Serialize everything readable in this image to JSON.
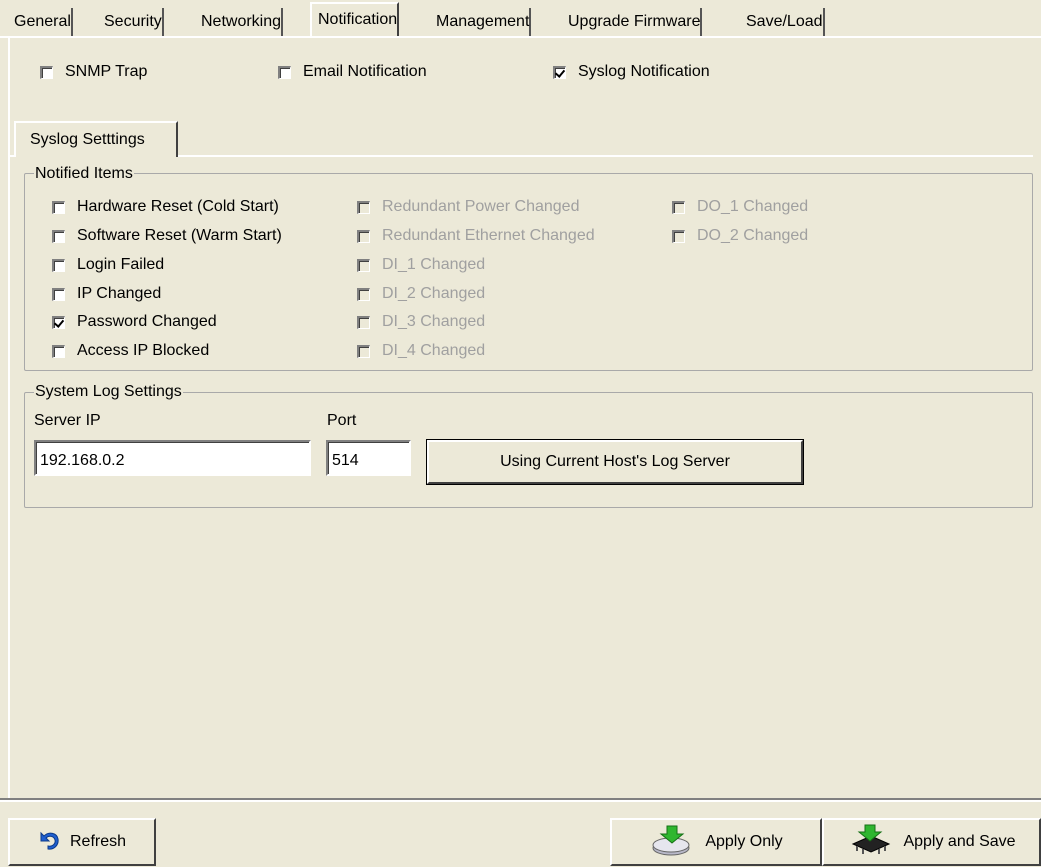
{
  "tabs": [
    "General",
    "Security",
    "Networking",
    "Notification",
    "Management",
    "Upgrade Firmware",
    "Save/Load"
  ],
  "active_tab": "Notification",
  "notification_types": [
    {
      "label": "SNMP Trap",
      "checked": false
    },
    {
      "label": "Email Notification",
      "checked": false
    },
    {
      "label": "Syslog Notification",
      "checked": true
    }
  ],
  "sub_tab": "Syslog Setttings",
  "notified_items": {
    "legend": "Notified Items",
    "col1": [
      {
        "label": "Hardware Reset (Cold Start)",
        "checked": false,
        "enabled": true
      },
      {
        "label": "Software Reset (Warm Start)",
        "checked": false,
        "enabled": true
      },
      {
        "label": "Login Failed",
        "checked": false,
        "enabled": true
      },
      {
        "label": "IP Changed",
        "checked": false,
        "enabled": true
      },
      {
        "label": "Password Changed",
        "checked": true,
        "enabled": true
      },
      {
        "label": "Access IP Blocked",
        "checked": false,
        "enabled": true
      }
    ],
    "col2": [
      {
        "label": "Redundant Power Changed",
        "checked": false,
        "enabled": false
      },
      {
        "label": "Redundant Ethernet Changed",
        "checked": false,
        "enabled": false
      },
      {
        "label": "DI_1 Changed",
        "checked": false,
        "enabled": false
      },
      {
        "label": "DI_2 Changed",
        "checked": false,
        "enabled": false
      },
      {
        "label": "DI_3 Changed",
        "checked": false,
        "enabled": false
      },
      {
        "label": "DI_4 Changed",
        "checked": false,
        "enabled": false
      }
    ],
    "col3": [
      {
        "label": "DO_1 Changed",
        "checked": false,
        "enabled": false
      },
      {
        "label": "DO_2 Changed",
        "checked": false,
        "enabled": false
      }
    ]
  },
  "system_log": {
    "legend": "System Log Settings",
    "server_ip_label": "Server IP",
    "server_ip_value": "192.168.0.2",
    "port_label": "Port",
    "port_value": "514",
    "use_host_button": "Using Current Host's Log Server"
  },
  "footer": {
    "refresh": "Refresh",
    "apply_only": "Apply Only",
    "apply_save": "Apply and Save"
  },
  "colors": {
    "background": "#ece9d8",
    "disabled_text": "#a0a0a0"
  }
}
